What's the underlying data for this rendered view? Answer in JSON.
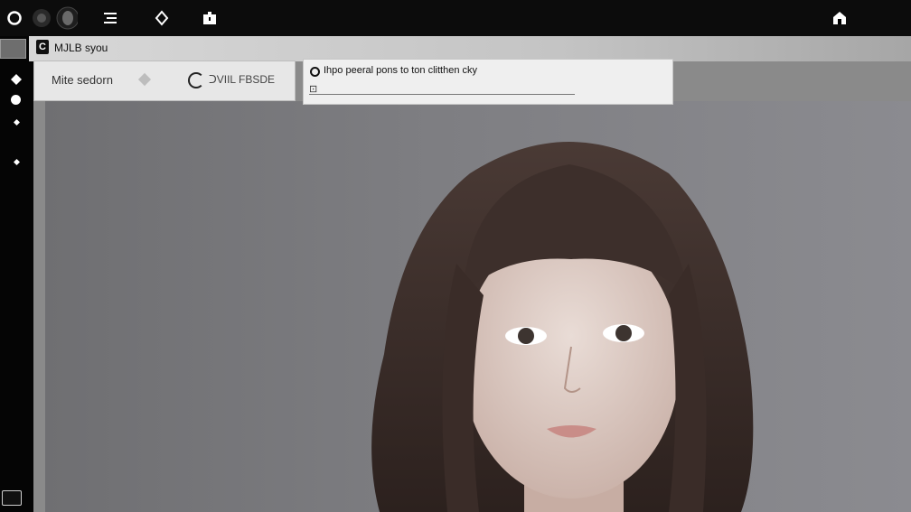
{
  "topbar": {
    "icons": [
      "circle-outline-icon",
      "dark-circle-icon",
      "camera-lens-icon",
      "menu-lines-icon",
      "diamond-move-icon",
      "box-icon",
      "home-icon"
    ]
  },
  "tab": {
    "logo": "C",
    "title": "MJLB syou"
  },
  "left_panel": {
    "label1": "Mite sedorn",
    "label2": "ᑐVIIL FBSDE"
  },
  "prompt_panel": {
    "text": "Ihpo peeral pons to ton clitthen cky",
    "inline_icon": "⊡"
  },
  "sidebar": {
    "icons": [
      "image-thumb-icon",
      "diamond-icon",
      "circle-icon",
      "small-diamond-icon",
      "small-diamond-icon",
      "panel-toggle-icon"
    ]
  }
}
